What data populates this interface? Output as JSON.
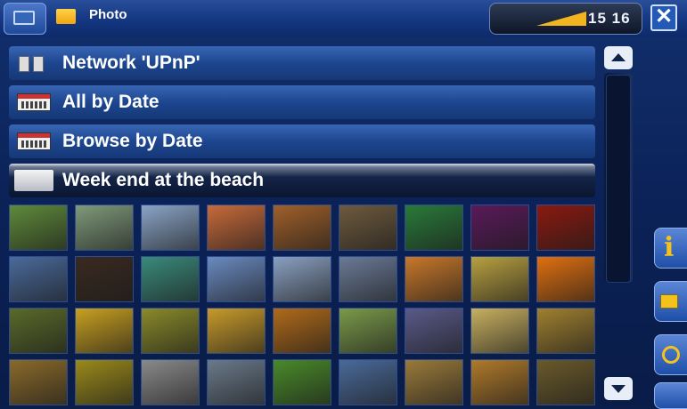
{
  "header": {
    "title": "Photo",
    "clock": "15 16",
    "close_glyph": "✕",
    "icons": [
      "menu-icon",
      "folder-icon",
      "battery-icon",
      "close-icon"
    ]
  },
  "list": {
    "items": [
      {
        "label": "Network 'UPnP'",
        "icon": "network-icon",
        "selected": false
      },
      {
        "label": "All by Date",
        "icon": "calendar-icon",
        "selected": false
      },
      {
        "label": "Browse by Date",
        "icon": "calendar-icon",
        "selected": false
      },
      {
        "label": "Week end at the beach",
        "icon": "folder-icon",
        "selected": true
      }
    ]
  },
  "side_buttons": {
    "info_glyph": "i",
    "icons": [
      "info-icon",
      "mail-icon",
      "edit-icon",
      "more-icon"
    ]
  },
  "thumbnails": {
    "colors": [
      [
        "#5f8a3a",
        "#7f9a7a",
        "#8aa4c6",
        "#c86a3a",
        "#a0602a",
        "#6e5a3e",
        "#2a7a3a",
        "#5a1a5a",
        "#8a1a10"
      ],
      [
        "#4a6a9a",
        "#3a2a20",
        "#3a8a7a",
        "#6a8ac0",
        "#8aa0c0",
        "#6a7a96",
        "#c8782a",
        "#b8a040",
        "#e07010"
      ],
      [
        "#5a6a2a",
        "#c8a020",
        "#8a8a2a",
        "#c89a2a",
        "#b06a1a",
        "#7a9a4a",
        "#5a5a8a",
        "#c8b060",
        "#a08030"
      ],
      [
        "#8a6a2a",
        "#9a8a1a",
        "#8a8a8a",
        "#6a7a8a",
        "#4a8a2a",
        "#4a6a9a",
        "#9a7a3a",
        "#b07a2a",
        "#6a5a2a"
      ]
    ]
  }
}
